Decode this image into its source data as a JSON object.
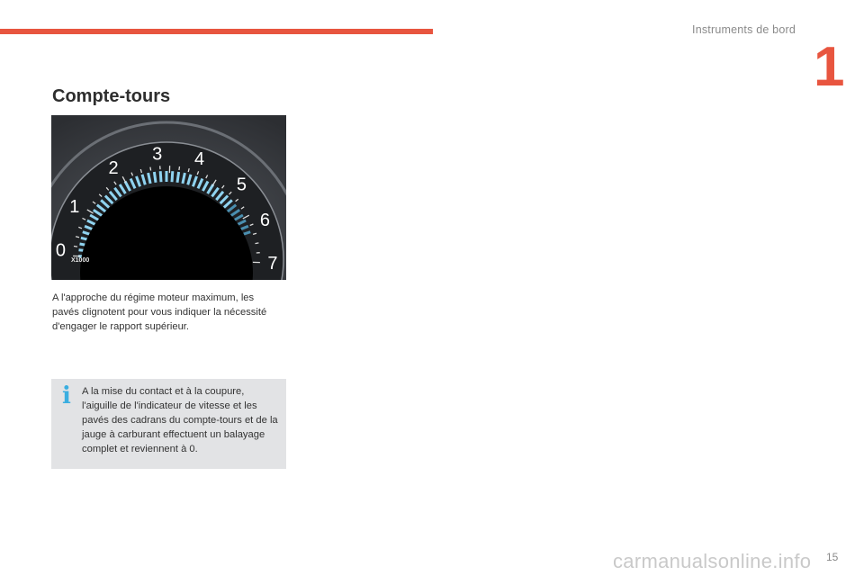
{
  "header": {
    "section_label": "Instruments de bord",
    "chapter_number": "1",
    "accent_color": "#e8553f"
  },
  "title": "Compte-tours",
  "gauge": {
    "ticks": [
      "0",
      "1",
      "2",
      "3",
      "4",
      "5",
      "6",
      "7"
    ],
    "unit": "X1000",
    "arc_color": "#8fd3f0"
  },
  "body_text": "A l'approche du régime moteur maximum, les pavés clignotent pour vous indiquer la nécessité d'engager le rapport supérieur.",
  "info_box": {
    "icon": "info-icon",
    "text": "A la mise du contact et à la coupure, l'aiguille de l'indicateur de vitesse et les pavés des cadrans du compte-tours et de la jauge à carburant effectuent un balayage complet et reviennent à 0."
  },
  "footer": {
    "page_number": "15",
    "watermark": "carmanualsonline.info"
  }
}
